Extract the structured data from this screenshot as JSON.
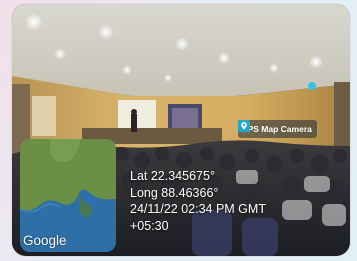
{
  "badge": {
    "label": "GPS Map Camera",
    "icon": "map-camera-icon"
  },
  "map": {
    "brand": "Google"
  },
  "location": {
    "lat": "Lat 22.345675°",
    "long": "Long 88.46366°",
    "datetime": "24/11/22 02:34 PM GMT",
    "tz": "+05:30"
  },
  "colors": {
    "accent": "#34c3e8",
    "map_water": "#2f6fa8",
    "map_land": "#6a8f45"
  }
}
